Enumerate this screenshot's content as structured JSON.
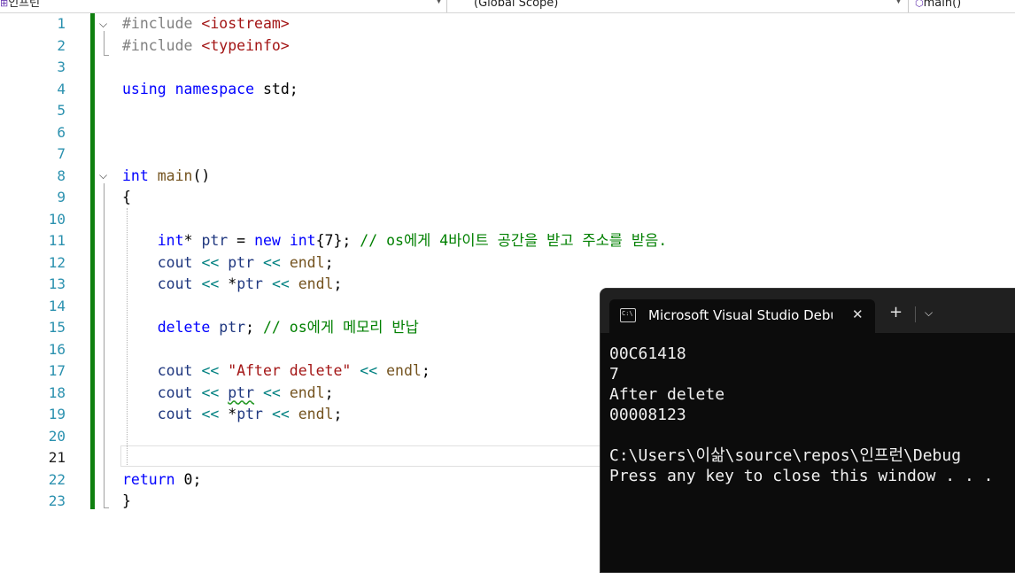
{
  "nav": {
    "project": "인프런",
    "scope": "(Global Scope)",
    "member": "main()"
  },
  "editor": {
    "current_line": 21,
    "lines": [
      {
        "n": "1",
        "tokens": [
          {
            "t": "#include ",
            "c": "pp"
          },
          {
            "t": "<iostream>",
            "c": "inc"
          }
        ]
      },
      {
        "n": "2",
        "tokens": [
          {
            "t": "#include ",
            "c": "pp"
          },
          {
            "t": "<typeinfo>",
            "c": "inc"
          }
        ]
      },
      {
        "n": "3",
        "tokens": []
      },
      {
        "n": "4",
        "tokens": [
          {
            "t": "using",
            "c": "kw"
          },
          {
            "t": " "
          },
          {
            "t": "namespace",
            "c": "kw"
          },
          {
            "t": " std;"
          }
        ]
      },
      {
        "n": "5",
        "tokens": []
      },
      {
        "n": "6",
        "tokens": []
      },
      {
        "n": "7",
        "tokens": []
      },
      {
        "n": "8",
        "tokens": [
          {
            "t": "int",
            "c": "kw"
          },
          {
            "t": " "
          },
          {
            "t": "main",
            "c": "fn"
          },
          {
            "t": "()"
          }
        ]
      },
      {
        "n": "9",
        "tokens": [
          {
            "t": "{"
          }
        ]
      },
      {
        "n": "10",
        "tokens": []
      },
      {
        "n": "11",
        "tokens": [
          {
            "t": "    "
          },
          {
            "t": "int",
            "c": "kw"
          },
          {
            "t": "* "
          },
          {
            "t": "ptr",
            "c": "var"
          },
          {
            "t": " = "
          },
          {
            "t": "new",
            "c": "kw"
          },
          {
            "t": " "
          },
          {
            "t": "int",
            "c": "kw"
          },
          {
            "t": "{7}; "
          },
          {
            "t": "// os에게 4바이트 공간을 받고 주소를 받음.",
            "c": "cm"
          }
        ]
      },
      {
        "n": "12",
        "tokens": [
          {
            "t": "    "
          },
          {
            "t": "cout",
            "c": "id"
          },
          {
            "t": " "
          },
          {
            "t": "<<",
            "c": "op"
          },
          {
            "t": " "
          },
          {
            "t": "ptr",
            "c": "var"
          },
          {
            "t": " "
          },
          {
            "t": "<<",
            "c": "op"
          },
          {
            "t": " "
          },
          {
            "t": "endl",
            "c": "fn"
          },
          {
            "t": ";"
          }
        ]
      },
      {
        "n": "13",
        "tokens": [
          {
            "t": "    "
          },
          {
            "t": "cout",
            "c": "id"
          },
          {
            "t": " "
          },
          {
            "t": "<<",
            "c": "op"
          },
          {
            "t": " *"
          },
          {
            "t": "ptr",
            "c": "var"
          },
          {
            "t": " "
          },
          {
            "t": "<<",
            "c": "op"
          },
          {
            "t": " "
          },
          {
            "t": "endl",
            "c": "fn"
          },
          {
            "t": ";"
          }
        ]
      },
      {
        "n": "14",
        "tokens": []
      },
      {
        "n": "15",
        "tokens": [
          {
            "t": "    "
          },
          {
            "t": "delete",
            "c": "kw"
          },
          {
            "t": " "
          },
          {
            "t": "ptr",
            "c": "var"
          },
          {
            "t": "; "
          },
          {
            "t": "// os에게 메모리 반납",
            "c": "cm"
          }
        ]
      },
      {
        "n": "16",
        "tokens": []
      },
      {
        "n": "17",
        "tokens": [
          {
            "t": "    "
          },
          {
            "t": "cout",
            "c": "id"
          },
          {
            "t": " "
          },
          {
            "t": "<<",
            "c": "op"
          },
          {
            "t": " "
          },
          {
            "t": "\"After delete\"",
            "c": "str"
          },
          {
            "t": " "
          },
          {
            "t": "<<",
            "c": "op"
          },
          {
            "t": " "
          },
          {
            "t": "endl",
            "c": "fn"
          },
          {
            "t": ";"
          }
        ]
      },
      {
        "n": "18",
        "tokens": [
          {
            "t": "    "
          },
          {
            "t": "cout",
            "c": "id"
          },
          {
            "t": " "
          },
          {
            "t": "<<",
            "c": "op"
          },
          {
            "t": " "
          },
          {
            "t": "ptr",
            "c": "var squig"
          },
          {
            "t": " "
          },
          {
            "t": "<<",
            "c": "op"
          },
          {
            "t": " "
          },
          {
            "t": "endl",
            "c": "fn"
          },
          {
            "t": ";"
          }
        ]
      },
      {
        "n": "19",
        "tokens": [
          {
            "t": "    "
          },
          {
            "t": "cout",
            "c": "id"
          },
          {
            "t": " "
          },
          {
            "t": "<<",
            "c": "op"
          },
          {
            "t": " *"
          },
          {
            "t": "ptr",
            "c": "var"
          },
          {
            "t": " "
          },
          {
            "t": "<<",
            "c": "op"
          },
          {
            "t": " "
          },
          {
            "t": "endl",
            "c": "fn"
          },
          {
            "t": ";"
          }
        ]
      },
      {
        "n": "20",
        "tokens": []
      },
      {
        "n": "21",
        "tokens": []
      },
      {
        "n": "22",
        "tokens": [
          {
            "t": "return",
            "c": "kw"
          },
          {
            "t": " 0;"
          }
        ]
      },
      {
        "n": "23",
        "tokens": [
          {
            "t": "}"
          }
        ]
      }
    ]
  },
  "console": {
    "tab_title": "Microsoft Visual Studio Debug",
    "icon_label": "C:\\",
    "close_glyph": "✕",
    "add_glyph": "+",
    "dropdown_glyph": "⌵",
    "output": [
      "00C61418",
      "7",
      "After delete",
      "00008123",
      "",
      "C:\\Users\\이삶\\source\\repos\\인프런\\Debug",
      "Press any key to close this window . . ."
    ]
  }
}
